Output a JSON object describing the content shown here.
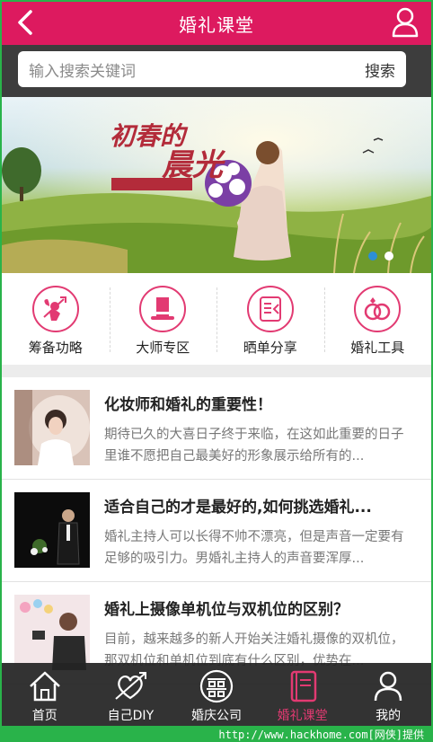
{
  "header": {
    "title": "婚礼课堂",
    "back_icon": "chevron-left-icon",
    "user_icon": "user-icon",
    "bg_color": "#dd1a5f"
  },
  "search": {
    "placeholder": "输入搜索关键词",
    "button_label": "搜索"
  },
  "banner": {
    "caption_line1": "初春的",
    "caption_line2": "晨光",
    "slide_count": 2,
    "active_slide": 1
  },
  "categories": [
    {
      "label": "筹备功略",
      "icon": "cupid-icon"
    },
    {
      "label": "大师专区",
      "icon": "top-hat-icon"
    },
    {
      "label": "晒单分享",
      "icon": "share-card-icon"
    },
    {
      "label": "婚礼工具",
      "icon": "rings-icon"
    }
  ],
  "articles": [
    {
      "title": "化妆师和婚礼的重要性！",
      "desc": "期待已久的大喜日子终于来临，在这如此重要的日子里谁不愿把自己最美好的形象展示给所有的..."
    },
    {
      "title": "适合自己的才是最好的,如何挑选婚礼...",
      "desc": "婚礼主持人可以长得不帅不漂亮，但是声音一定要有足够的吸引力。男婚礼主持人的声音要浑厚..."
    },
    {
      "title": "婚礼上摄像单机位与双机位的区别？",
      "desc": "目前，越来越多的新人开始关注婚礼摄像的双机位，那双机位和单机位到底有什么区别，优势在..."
    }
  ],
  "tabbar": {
    "items": [
      {
        "label": "首页",
        "icon": "home-icon"
      },
      {
        "label": "自己DIY",
        "icon": "heart-arrow-icon"
      },
      {
        "label": "婚庆公司",
        "icon": "double-happiness-icon"
      },
      {
        "label": "婚礼课堂",
        "icon": "book-icon",
        "active": true
      },
      {
        "label": "我的",
        "icon": "user-icon"
      }
    ],
    "active_color": "#e23a72"
  },
  "watermark": "http://www.hackhome.com[网侠]提供"
}
